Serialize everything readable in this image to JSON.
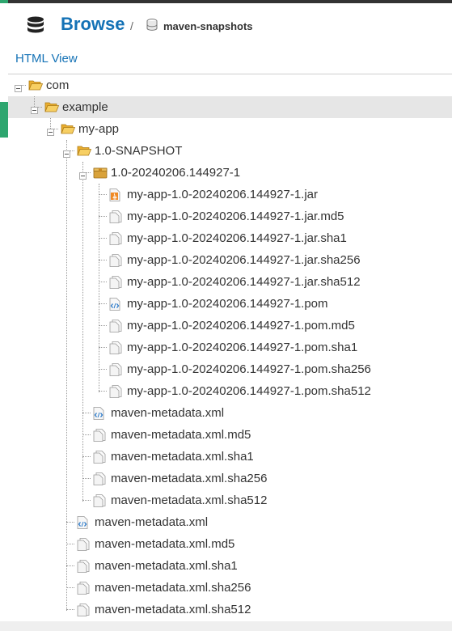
{
  "header": {
    "title": "Browse",
    "separator": "/",
    "repository": "maven-snapshots"
  },
  "html_view_label": "HTML View",
  "tree": [
    {
      "label": "com",
      "icon": "folder-open-icon",
      "level": 0,
      "expanded": true
    },
    {
      "label": "example",
      "icon": "folder-open-icon",
      "level": 1,
      "expanded": true,
      "selected": true
    },
    {
      "label": "my-app",
      "icon": "folder-open-icon",
      "level": 2,
      "expanded": true
    },
    {
      "label": "1.0-SNAPSHOT",
      "icon": "folder-open-icon",
      "level": 3,
      "expanded": true
    },
    {
      "label": "1.0-20240206.144927-1",
      "icon": "package-icon",
      "level": 4,
      "expanded": true
    },
    {
      "label": "my-app-1.0-20240206.144927-1.jar",
      "icon": "jar-file-icon",
      "level": 5
    },
    {
      "label": "my-app-1.0-20240206.144927-1.jar.md5",
      "icon": "file-icon",
      "level": 5
    },
    {
      "label": "my-app-1.0-20240206.144927-1.jar.sha1",
      "icon": "file-icon",
      "level": 5
    },
    {
      "label": "my-app-1.0-20240206.144927-1.jar.sha256",
      "icon": "file-icon",
      "level": 5
    },
    {
      "label": "my-app-1.0-20240206.144927-1.jar.sha512",
      "icon": "file-icon",
      "level": 5
    },
    {
      "label": "my-app-1.0-20240206.144927-1.pom",
      "icon": "xml-file-icon",
      "level": 5
    },
    {
      "label": "my-app-1.0-20240206.144927-1.pom.md5",
      "icon": "file-icon",
      "level": 5
    },
    {
      "label": "my-app-1.0-20240206.144927-1.pom.sha1",
      "icon": "file-icon",
      "level": 5
    },
    {
      "label": "my-app-1.0-20240206.144927-1.pom.sha256",
      "icon": "file-icon",
      "level": 5
    },
    {
      "label": "my-app-1.0-20240206.144927-1.pom.sha512",
      "icon": "file-icon",
      "level": 5
    },
    {
      "label": "maven-metadata.xml",
      "icon": "xml-file-icon",
      "level": 4
    },
    {
      "label": "maven-metadata.xml.md5",
      "icon": "file-icon",
      "level": 4
    },
    {
      "label": "maven-metadata.xml.sha1",
      "icon": "file-icon",
      "level": 4
    },
    {
      "label": "maven-metadata.xml.sha256",
      "icon": "file-icon",
      "level": 4
    },
    {
      "label": "maven-metadata.xml.sha512",
      "icon": "file-icon",
      "level": 4
    },
    {
      "label": "maven-metadata.xml",
      "icon": "xml-file-icon",
      "level": 3
    },
    {
      "label": "maven-metadata.xml.md5",
      "icon": "file-icon",
      "level": 3
    },
    {
      "label": "maven-metadata.xml.sha1",
      "icon": "file-icon",
      "level": 3
    },
    {
      "label": "maven-metadata.xml.sha256",
      "icon": "file-icon",
      "level": 3
    },
    {
      "label": "maven-metadata.xml.sha512",
      "icon": "file-icon",
      "level": 3
    }
  ],
  "colors": {
    "accent": "#1472b6",
    "active_indicator": "#2ea66f",
    "selected_row": "#e6e6e6",
    "folder": "#f2c14e"
  }
}
